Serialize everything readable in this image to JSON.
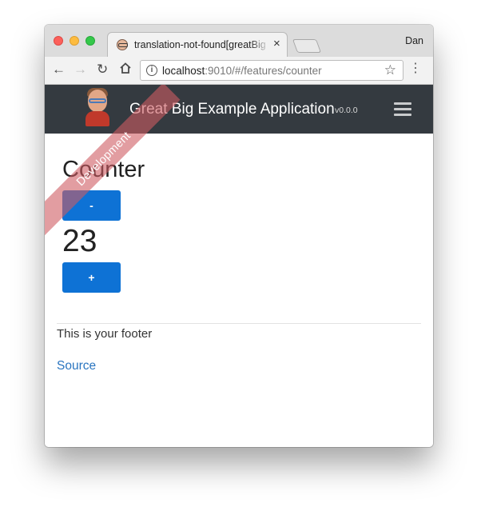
{
  "browser": {
    "tab_title": "translation-not-found[greatBig",
    "tab_close": "×",
    "profile_name": "Dan",
    "back_icon": "arrow-left-icon",
    "forward_icon": "arrow-right-icon",
    "reload_icon": "reload-icon",
    "home_icon": "home-icon",
    "url_host": "localhost",
    "url_path": ":9010/#/features/counter",
    "star_icon": "star-icon",
    "menu_icon": "vertical-dots-icon"
  },
  "navbar": {
    "brand_title": "Great Big Example Application",
    "version": "v0.0.0",
    "background": "#343a40"
  },
  "ribbon": {
    "label": "Development",
    "color": "#ce5c62"
  },
  "counter": {
    "title": "Counter",
    "decrement_label": "-",
    "value": "23",
    "increment_label": "+",
    "button_color": "#0e72d5"
  },
  "footer": {
    "text": "This is your footer",
    "link_label": "Source",
    "link_color": "#2a75c0"
  }
}
